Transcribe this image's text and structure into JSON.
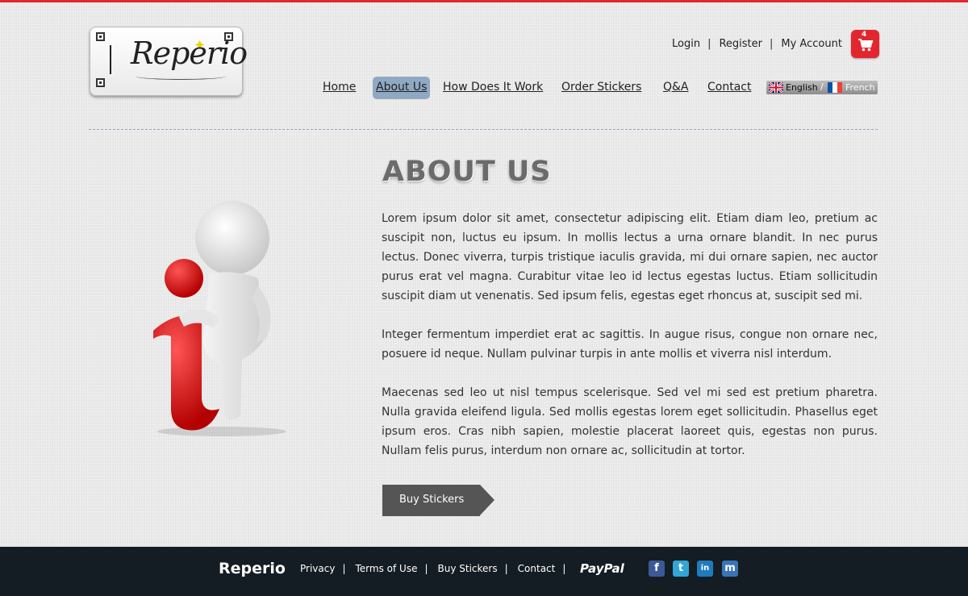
{
  "brand": {
    "logo_text": "Reperio"
  },
  "account": {
    "login": "Login",
    "register": "Register",
    "my_account": "My Account",
    "separator": "|"
  },
  "cart": {
    "count": "4"
  },
  "nav": {
    "items": [
      {
        "label": "Home",
        "active": false
      },
      {
        "label": "About Us",
        "active": true
      },
      {
        "label": "How Does It Work",
        "active": false
      },
      {
        "label": "Order Stickers",
        "active": false
      },
      {
        "label": "Q&A",
        "active": false
      },
      {
        "label": "Contact",
        "active": false
      }
    ]
  },
  "language": {
    "english": "English",
    "separator": "/",
    "french": "French"
  },
  "page": {
    "title": "ABOUT US",
    "paragraphs": [
      "Lorem ipsum dolor sit amet, consectetur adipiscing elit. Etiam diam leo, pretium ac suscipit non, luctus eu ipsum. In mollis lectus a urna ornare blandit. In nec purus lectus. Donec viverra, turpis tristique iaculis gravida, mi dui ornare sapien, nec auctor purus erat vel magna. Curabitur vitae leo id lectus egestas luctus. Etiam sollicitudin suscipit diam ut venenatis. Sed ipsum felis, egestas eget rhoncus at, suscipit sed mi.",
      "Integer fermentum imperdiet erat ac sagittis. In augue risus, congue non ornare nec, posuere id neque. Nullam pulvinar turpis in ante mollis et viverra nisl interdum.",
      "Maecenas sed leo ut nisl tempus scelerisque. Sed vel mi sed est pretium pharetra. Nulla gravida eleifend ligula. Sed mollis egestas lorem eget sollicitudin. Phasellus eget ipsum eros. Cras nibh sapien, molestie placerat laoreet quis, egestas non purus. Nullam felis purus, interdum non ornare ac, sollicitudin at tortor."
    ],
    "cta": "Buy Stickers"
  },
  "footer": {
    "brand": "Reperio",
    "links": [
      "Privacy",
      "Terms of Use",
      "Buy Stickers",
      "Contact"
    ],
    "separator": "|",
    "paypal": "PayPal",
    "social": [
      {
        "icon": "facebook-icon",
        "glyph": "f",
        "color": "#3b5998"
      },
      {
        "icon": "twitter-icon",
        "glyph": "t",
        "color": "#33a6d6"
      },
      {
        "icon": "linkedin-icon",
        "glyph": "in",
        "color": "#1f7bbb"
      },
      {
        "icon": "myspace-icon",
        "glyph": "m",
        "color": "#3a73b8"
      }
    ]
  },
  "colors": {
    "accent": "#e3262e",
    "nav_active": "#8fa9c3",
    "footer_bg": "#141d23",
    "button": "#555555"
  }
}
